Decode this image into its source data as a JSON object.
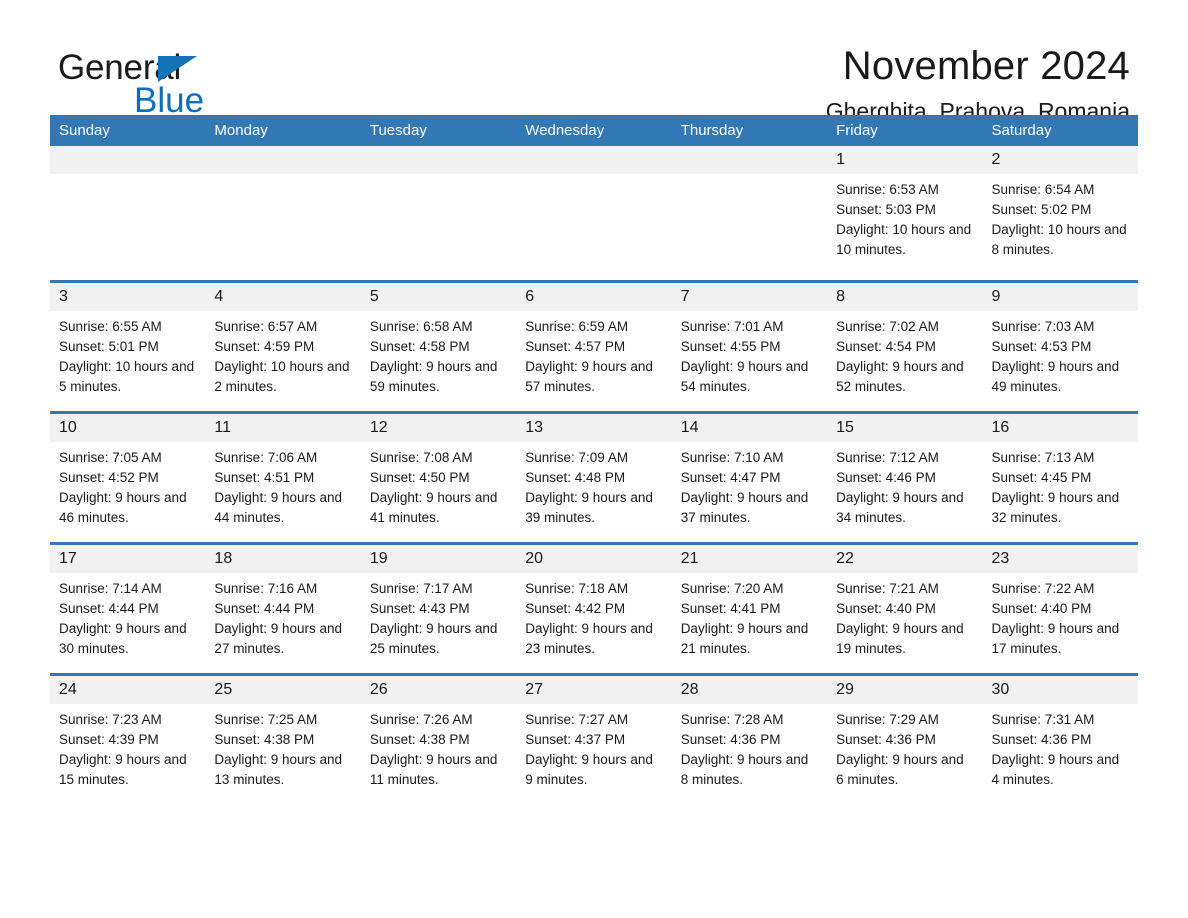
{
  "brand": {
    "word_one": "General",
    "word_two": "Blue",
    "triangle_color": "#1672b6",
    "blue_color": "#0a6fc2"
  },
  "header": {
    "title": "November 2024",
    "location": "Gherghita, Prahova, Romania"
  },
  "theme": {
    "header_blue": "#3277b6",
    "day_band_gray": "#f1f1f1",
    "text_color": "#1a1a1a"
  },
  "weekdays": [
    "Sunday",
    "Monday",
    "Tuesday",
    "Wednesday",
    "Thursday",
    "Friday",
    "Saturday"
  ],
  "weeks": [
    [
      {
        "day": "",
        "sunrise": "",
        "sunset": "",
        "daylight": "",
        "empty": true
      },
      {
        "day": "",
        "sunrise": "",
        "sunset": "",
        "daylight": "",
        "empty": true
      },
      {
        "day": "",
        "sunrise": "",
        "sunset": "",
        "daylight": "",
        "empty": true
      },
      {
        "day": "",
        "sunrise": "",
        "sunset": "",
        "daylight": "",
        "empty": true
      },
      {
        "day": "",
        "sunrise": "",
        "sunset": "",
        "daylight": "",
        "empty": true
      },
      {
        "day": "1",
        "sunrise": "Sunrise: 6:53 AM",
        "sunset": "Sunset: 5:03 PM",
        "daylight": "Daylight: 10 hours and 10 minutes.",
        "empty": false
      },
      {
        "day": "2",
        "sunrise": "Sunrise: 6:54 AM",
        "sunset": "Sunset: 5:02 PM",
        "daylight": "Daylight: 10 hours and 8 minutes.",
        "empty": false
      }
    ],
    [
      {
        "day": "3",
        "sunrise": "Sunrise: 6:55 AM",
        "sunset": "Sunset: 5:01 PM",
        "daylight": "Daylight: 10 hours and 5 minutes.",
        "empty": false
      },
      {
        "day": "4",
        "sunrise": "Sunrise: 6:57 AM",
        "sunset": "Sunset: 4:59 PM",
        "daylight": "Daylight: 10 hours and 2 minutes.",
        "empty": false
      },
      {
        "day": "5",
        "sunrise": "Sunrise: 6:58 AM",
        "sunset": "Sunset: 4:58 PM",
        "daylight": "Daylight: 9 hours and 59 minutes.",
        "empty": false
      },
      {
        "day": "6",
        "sunrise": "Sunrise: 6:59 AM",
        "sunset": "Sunset: 4:57 PM",
        "daylight": "Daylight: 9 hours and 57 minutes.",
        "empty": false
      },
      {
        "day": "7",
        "sunrise": "Sunrise: 7:01 AM",
        "sunset": "Sunset: 4:55 PM",
        "daylight": "Daylight: 9 hours and 54 minutes.",
        "empty": false
      },
      {
        "day": "8",
        "sunrise": "Sunrise: 7:02 AM",
        "sunset": "Sunset: 4:54 PM",
        "daylight": "Daylight: 9 hours and 52 minutes.",
        "empty": false
      },
      {
        "day": "9",
        "sunrise": "Sunrise: 7:03 AM",
        "sunset": "Sunset: 4:53 PM",
        "daylight": "Daylight: 9 hours and 49 minutes.",
        "empty": false
      }
    ],
    [
      {
        "day": "10",
        "sunrise": "Sunrise: 7:05 AM",
        "sunset": "Sunset: 4:52 PM",
        "daylight": "Daylight: 9 hours and 46 minutes.",
        "empty": false
      },
      {
        "day": "11",
        "sunrise": "Sunrise: 7:06 AM",
        "sunset": "Sunset: 4:51 PM",
        "daylight": "Daylight: 9 hours and 44 minutes.",
        "empty": false
      },
      {
        "day": "12",
        "sunrise": "Sunrise: 7:08 AM",
        "sunset": "Sunset: 4:50 PM",
        "daylight": "Daylight: 9 hours and 41 minutes.",
        "empty": false
      },
      {
        "day": "13",
        "sunrise": "Sunrise: 7:09 AM",
        "sunset": "Sunset: 4:48 PM",
        "daylight": "Daylight: 9 hours and 39 minutes.",
        "empty": false
      },
      {
        "day": "14",
        "sunrise": "Sunrise: 7:10 AM",
        "sunset": "Sunset: 4:47 PM",
        "daylight": "Daylight: 9 hours and 37 minutes.",
        "empty": false
      },
      {
        "day": "15",
        "sunrise": "Sunrise: 7:12 AM",
        "sunset": "Sunset: 4:46 PM",
        "daylight": "Daylight: 9 hours and 34 minutes.",
        "empty": false
      },
      {
        "day": "16",
        "sunrise": "Sunrise: 7:13 AM",
        "sunset": "Sunset: 4:45 PM",
        "daylight": "Daylight: 9 hours and 32 minutes.",
        "empty": false
      }
    ],
    [
      {
        "day": "17",
        "sunrise": "Sunrise: 7:14 AM",
        "sunset": "Sunset: 4:44 PM",
        "daylight": "Daylight: 9 hours and 30 minutes.",
        "empty": false
      },
      {
        "day": "18",
        "sunrise": "Sunrise: 7:16 AM",
        "sunset": "Sunset: 4:44 PM",
        "daylight": "Daylight: 9 hours and 27 minutes.",
        "empty": false
      },
      {
        "day": "19",
        "sunrise": "Sunrise: 7:17 AM",
        "sunset": "Sunset: 4:43 PM",
        "daylight": "Daylight: 9 hours and 25 minutes.",
        "empty": false
      },
      {
        "day": "20",
        "sunrise": "Sunrise: 7:18 AM",
        "sunset": "Sunset: 4:42 PM",
        "daylight": "Daylight: 9 hours and 23 minutes.",
        "empty": false
      },
      {
        "day": "21",
        "sunrise": "Sunrise: 7:20 AM",
        "sunset": "Sunset: 4:41 PM",
        "daylight": "Daylight: 9 hours and 21 minutes.",
        "empty": false
      },
      {
        "day": "22",
        "sunrise": "Sunrise: 7:21 AM",
        "sunset": "Sunset: 4:40 PM",
        "daylight": "Daylight: 9 hours and 19 minutes.",
        "empty": false
      },
      {
        "day": "23",
        "sunrise": "Sunrise: 7:22 AM",
        "sunset": "Sunset: 4:40 PM",
        "daylight": "Daylight: 9 hours and 17 minutes.",
        "empty": false
      }
    ],
    [
      {
        "day": "24",
        "sunrise": "Sunrise: 7:23 AM",
        "sunset": "Sunset: 4:39 PM",
        "daylight": "Daylight: 9 hours and 15 minutes.",
        "empty": false
      },
      {
        "day": "25",
        "sunrise": "Sunrise: 7:25 AM",
        "sunset": "Sunset: 4:38 PM",
        "daylight": "Daylight: 9 hours and 13 minutes.",
        "empty": false
      },
      {
        "day": "26",
        "sunrise": "Sunrise: 7:26 AM",
        "sunset": "Sunset: 4:38 PM",
        "daylight": "Daylight: 9 hours and 11 minutes.",
        "empty": false
      },
      {
        "day": "27",
        "sunrise": "Sunrise: 7:27 AM",
        "sunset": "Sunset: 4:37 PM",
        "daylight": "Daylight: 9 hours and 9 minutes.",
        "empty": false
      },
      {
        "day": "28",
        "sunrise": "Sunrise: 7:28 AM",
        "sunset": "Sunset: 4:36 PM",
        "daylight": "Daylight: 9 hours and 8 minutes.",
        "empty": false
      },
      {
        "day": "29",
        "sunrise": "Sunrise: 7:29 AM",
        "sunset": "Sunset: 4:36 PM",
        "daylight": "Daylight: 9 hours and 6 minutes.",
        "empty": false
      },
      {
        "day": "30",
        "sunrise": "Sunrise: 7:31 AM",
        "sunset": "Sunset: 4:36 PM",
        "daylight": "Daylight: 9 hours and 4 minutes.",
        "empty": false
      }
    ]
  ]
}
